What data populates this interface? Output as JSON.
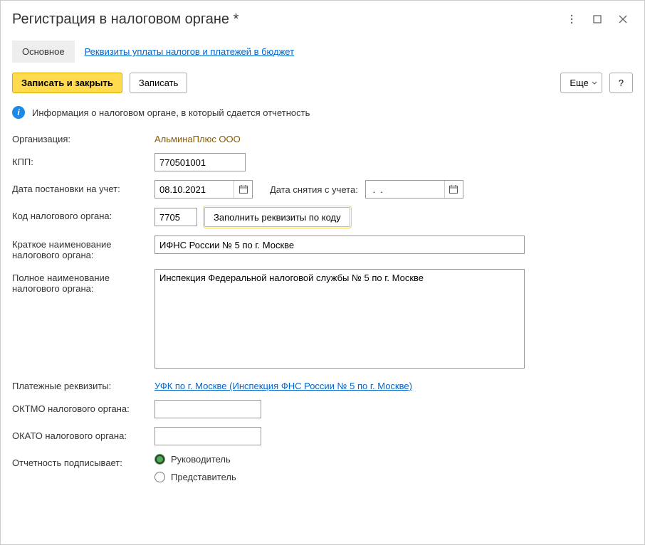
{
  "window": {
    "title": "Регистрация в налоговом органе *"
  },
  "tabs": {
    "main": "Основное",
    "requisites": "Реквизиты уплаты налогов и платежей в бюджет"
  },
  "toolbar": {
    "save_close": "Записать и закрыть",
    "save": "Записать",
    "more": "Еще",
    "help": "?"
  },
  "info": {
    "text": "Информация о налоговом органе, в который сдается отчетность"
  },
  "labels": {
    "organization": "Организация:",
    "kpp": "КПП:",
    "registration_date": "Дата постановки на учет:",
    "deregistration_date": "Дата снятия с учета:",
    "tax_code": "Код налогового органа:",
    "short_name": "Краткое наименование налогового органа:",
    "full_name": "Полное наименование налогового органа:",
    "payment_details": "Платежные реквизиты:",
    "oktmo": "ОКТМО налогового органа:",
    "okato": "ОКАТО налогового органа:",
    "signer": "Отчетность подписывает:"
  },
  "values": {
    "organization": "АльминаПлюс ООО",
    "kpp": "770501001",
    "registration_date": "08.10.2021",
    "deregistration_date": " .  .    ",
    "tax_code": "7705",
    "fill_by_code": "Заполнить реквизиты по коду",
    "short_name": "ИФНС России № 5 по г. Москве",
    "full_name": "Инспекция Федеральной налоговой службы № 5 по г. Москве",
    "payment_details_link": "УФК по г. Москве (Инспекция ФНС России № 5 по г. Москве)",
    "oktmo": "",
    "okato": ""
  },
  "radio": {
    "director": "Руководитель",
    "representative": "Представитель"
  }
}
